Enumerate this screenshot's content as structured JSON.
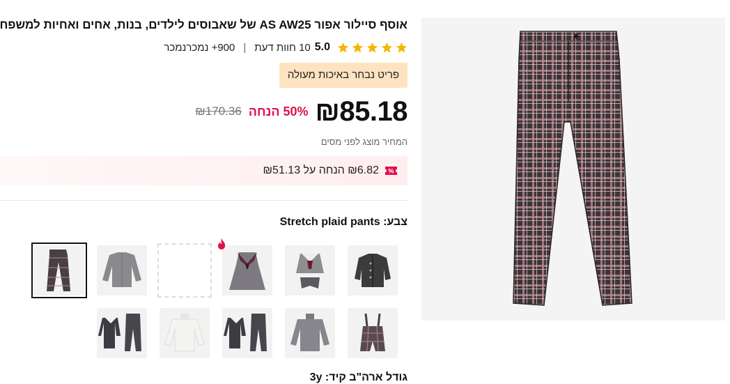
{
  "product": {
    "title": "אוסף סיילור אפור AS AW25 של שאבוסים לילדים, בנות, אחים ואחיות למשפחה",
    "rating": {
      "value": "5.0",
      "stars": 5,
      "reviews": "10 חוות דעת",
      "sold": "900+ נמכרנמכר"
    },
    "badge": "פריט נבחר באיכות מעולה",
    "price": {
      "current": "₪85.18",
      "discount": "50% הנחה",
      "original": "₪170.36"
    },
    "tax_note": "המחיר מוצג לפני מסים",
    "coupon": {
      "text": "₪6.82 הנחה על ₪51.13",
      "arrow": "›"
    },
    "color": {
      "label": "צבע:",
      "selected": "Stretch plaid pants"
    },
    "size": {
      "label": "גודל ארה\"ב קיד:",
      "selected": "3y"
    }
  },
  "swatches": [
    {
      "name": "cardigan-gray"
    },
    {
      "name": "dress-bow-set"
    },
    {
      "name": "sailor-dress",
      "hot": true
    },
    {
      "name": "empty"
    },
    {
      "name": "gray-blouse"
    },
    {
      "name": "plaid-pants",
      "selected": true
    },
    {
      "name": "plaid-overalls"
    },
    {
      "name": "gray-turtleneck"
    },
    {
      "name": "collar-overall-set"
    },
    {
      "name": "white-turtleneck"
    },
    {
      "name": "collar-overall-set-2"
    }
  ],
  "colors": {
    "star": "#f7b500",
    "discount": "#e0114a",
    "badge_bg": "#fde3bf",
    "coupon_icon": "#e0114a"
  }
}
